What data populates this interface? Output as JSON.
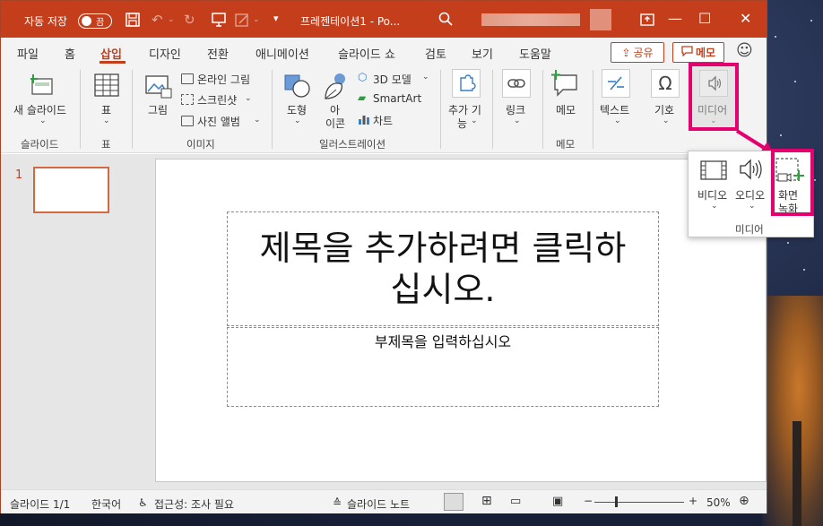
{
  "titlebar": {
    "autosave_label": "자동 저장",
    "toggle_text": "끔",
    "doc_title": "프레젠테이션1 - Po...",
    "minimize": "—",
    "restore": "☐",
    "close": "✕"
  },
  "tabs": [
    "파일",
    "홈",
    "삽입",
    "디자인",
    "전환",
    "애니메이션",
    "슬라이드 쇼",
    "검토",
    "보기",
    "도움말"
  ],
  "active_tab": "삽입",
  "share_label": "공유",
  "memo_label": "메모",
  "ribbon": {
    "new_slide": "새 슬라이드",
    "table": "표",
    "picture": "그림",
    "online_picture": "온라인 그림",
    "screenshot": "스크린샷",
    "photo_album": "사진 앨범",
    "shapes": "도형",
    "icons_line1": "아",
    "icons_line2": "이콘",
    "model3d": "3D 모델",
    "smartart": "SmartArt",
    "chart": "차트",
    "addins_line1": "추가 기",
    "addins_line2": "능",
    "link": "링크",
    "comment": "메모",
    "text": "텍스트",
    "symbols": "기호",
    "media": "미디어"
  },
  "groups": {
    "slides": "슬라이드",
    "tables": "표",
    "images": "이미지",
    "illustrations": "일러스트레이션",
    "comments": "메모"
  },
  "media_dropdown": {
    "video": "비디오",
    "audio": "오디오",
    "screen_record_line1": "화면",
    "screen_record_line2": "녹화",
    "group_label": "미디어"
  },
  "slides_pane": {
    "slide_number": "1"
  },
  "slide": {
    "title_placeholder_line1": "제목을 추가하려면 클릭하",
    "title_placeholder_line2": "십시오.",
    "subtitle_placeholder": "부제목을 입력하십시오"
  },
  "statusbar": {
    "slide_count": "슬라이드 1/1",
    "language": "한국어",
    "accessibility": "접근성: 조사 필요",
    "notes": "슬라이드 노트",
    "zoom_minus": "−",
    "zoom_plus": "+",
    "zoom_level": "50%"
  },
  "colors": {
    "accent": "#c43e1c",
    "highlight": "#e6006f"
  }
}
